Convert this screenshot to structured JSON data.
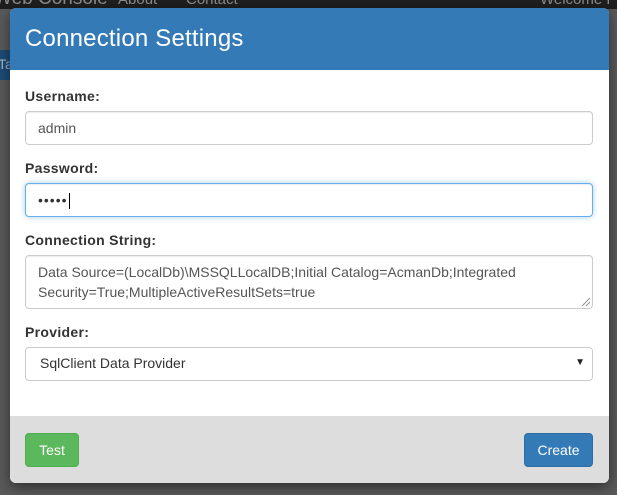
{
  "background": {
    "brand": "Web Console",
    "nav_about": "About",
    "nav_contact": "Contact",
    "welcome": "Welcome F",
    "strip_text": "Ta"
  },
  "modal": {
    "title": "Connection Settings",
    "username": {
      "label": "Username:",
      "value": "admin"
    },
    "password": {
      "label": "Password:",
      "masked_value": "•••••"
    },
    "connection_string": {
      "label": "Connection String:",
      "value": "Data Source=(LocalDb)\\MSSQLLocalDB;Initial Catalog=AcmanDb;Integrated Security=True;MultipleActiveResultSets=true"
    },
    "provider": {
      "label": "Provider:",
      "selected": "SqlClient Data Provider"
    },
    "footer": {
      "test_label": "Test",
      "create_label": "Create"
    }
  },
  "colors": {
    "primary": "#337ab7",
    "success": "#5cb85c",
    "footer_bg": "#dddddd"
  }
}
